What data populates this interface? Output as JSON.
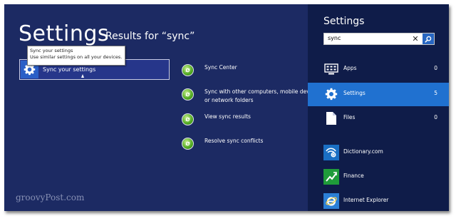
{
  "page": {
    "title": "Settings",
    "results_for": "Results for “sync”"
  },
  "tooltip": {
    "title": "Sync your settings",
    "description": "Use similar settings on all your devices."
  },
  "selected_result": {
    "label": "Sync your settings",
    "icon": "gear-icon"
  },
  "sync_results": [
    {
      "label": "Sync Center",
      "icon": "sync-icon"
    },
    {
      "label": "Sync with other computers, mobile devi\nor network folders",
      "icon": "sync-icon"
    },
    {
      "label": "View sync results",
      "icon": "sync-icon"
    },
    {
      "label": "Resolve sync conflicts",
      "icon": "sync-icon"
    }
  ],
  "watermark": "groovyPost.com",
  "charm": {
    "title": "Settings",
    "search_value": "sync",
    "clear_icon": "close-icon",
    "search_icon": "search-icon",
    "categories": [
      {
        "label": "Apps",
        "count": "0",
        "icon": "apps-icon",
        "selected": false
      },
      {
        "label": "Settings",
        "count": "5",
        "icon": "gear-icon",
        "selected": true
      },
      {
        "label": "Files",
        "count": "0",
        "icon": "file-icon",
        "selected": false
      }
    ],
    "apps": [
      {
        "label": "Dictionary.com",
        "icon": "dictionary-icon"
      },
      {
        "label": "Finance",
        "icon": "finance-icon"
      },
      {
        "label": "Internet Explorer",
        "icon": "internet-explorer-icon"
      }
    ]
  },
  "colors": {
    "background": "#1c2a63",
    "charm_background": "#0f1c49",
    "selection": "#2071d0",
    "search_button": "#2766c2"
  }
}
